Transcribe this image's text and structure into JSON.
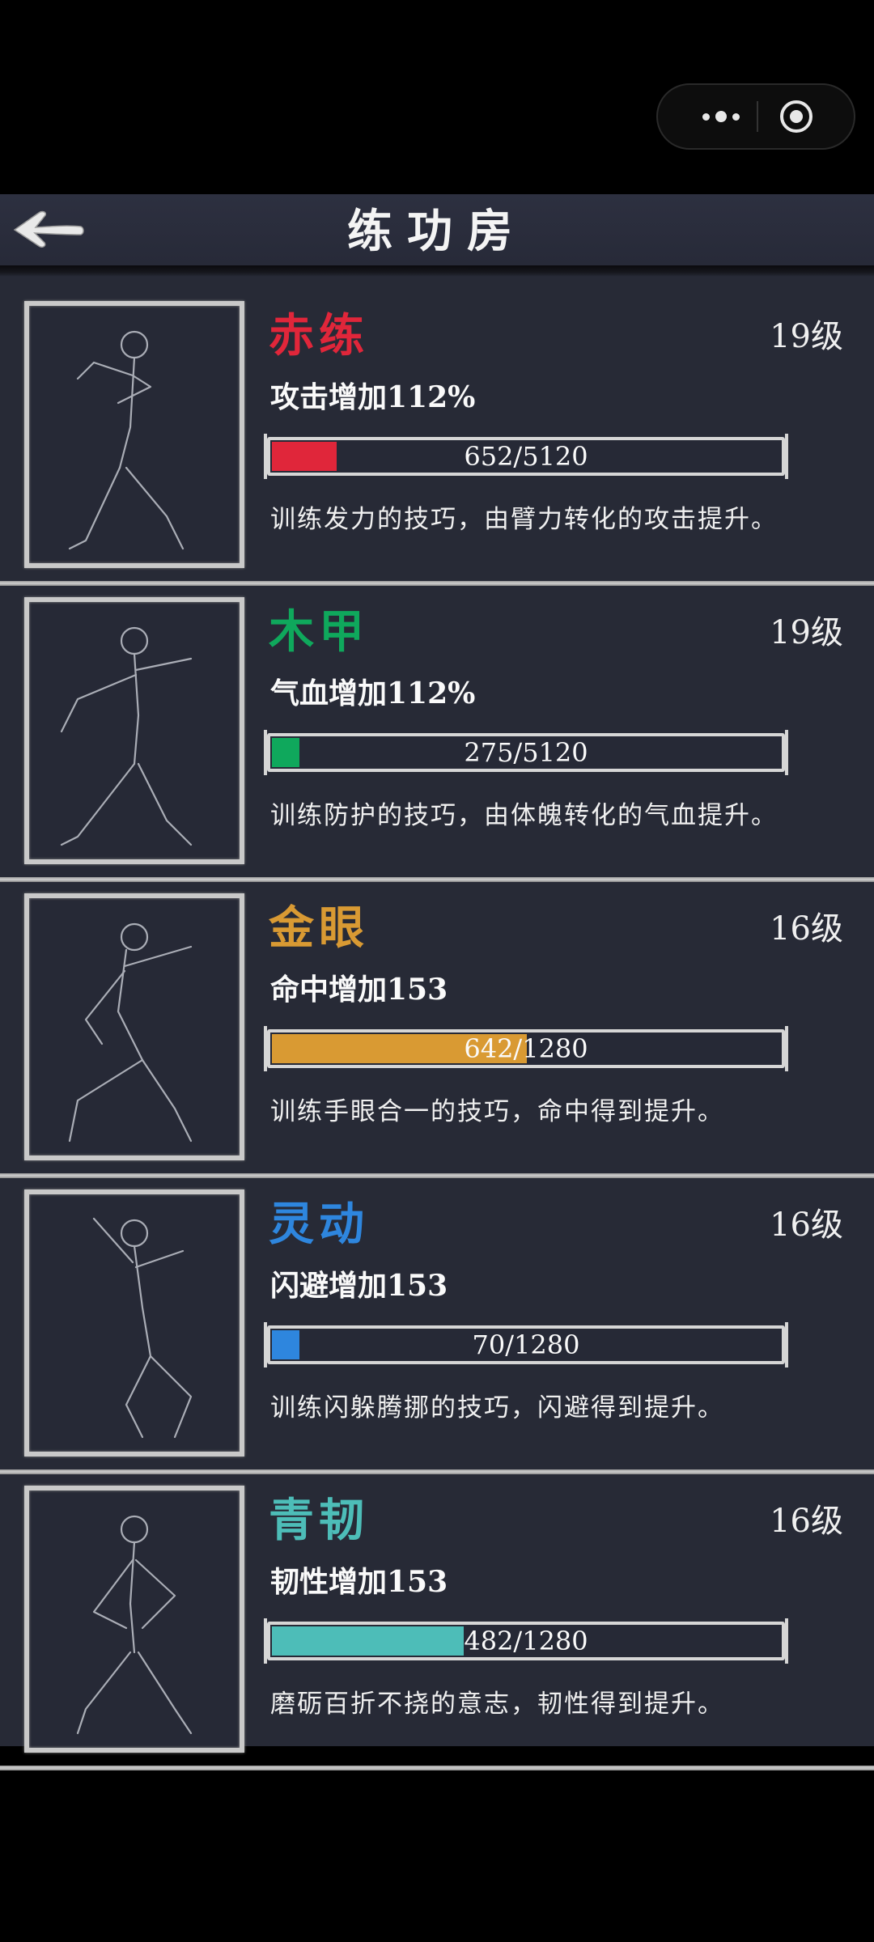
{
  "title": "练功房",
  "colors": {
    "red": "#e0263a",
    "green": "#0fa85c",
    "gold": "#d99a33",
    "blue": "#2e86de",
    "teal": "#4dbdb8"
  },
  "skills": [
    {
      "name": "赤练",
      "level": "19级",
      "stat": "攻击增加112%",
      "progress": "652/5120",
      "progress_ratio": 0.1273,
      "color": "#e0263a",
      "desc": "训练发力的技巧，由臂力转化的攻击提升。"
    },
    {
      "name": "木甲",
      "level": "19级",
      "stat": "气血增加112%",
      "progress": "275/5120",
      "progress_ratio": 0.0537,
      "color": "#0fa85c",
      "desc": "训练防护的技巧，由体魄转化的气血提升。"
    },
    {
      "name": "金眼",
      "level": "16级",
      "stat": "命中增加153",
      "progress": "642/1280",
      "progress_ratio": 0.5016,
      "color": "#d99a33",
      "desc": "训练手眼合一的技巧，命中得到提升。"
    },
    {
      "name": "灵动",
      "level": "16级",
      "stat": "闪避增加153",
      "progress": "70/1280",
      "progress_ratio": 0.0547,
      "color": "#2e86de",
      "desc": "训练闪躲腾挪的技巧，闪避得到提升。"
    },
    {
      "name": "青韧",
      "level": "16级",
      "stat": "韧性增加153",
      "progress": "482/1280",
      "progress_ratio": 0.3766,
      "color": "#4dbdb8",
      "desc": "磨砺百折不挠的意志，韧性得到提升。"
    }
  ]
}
